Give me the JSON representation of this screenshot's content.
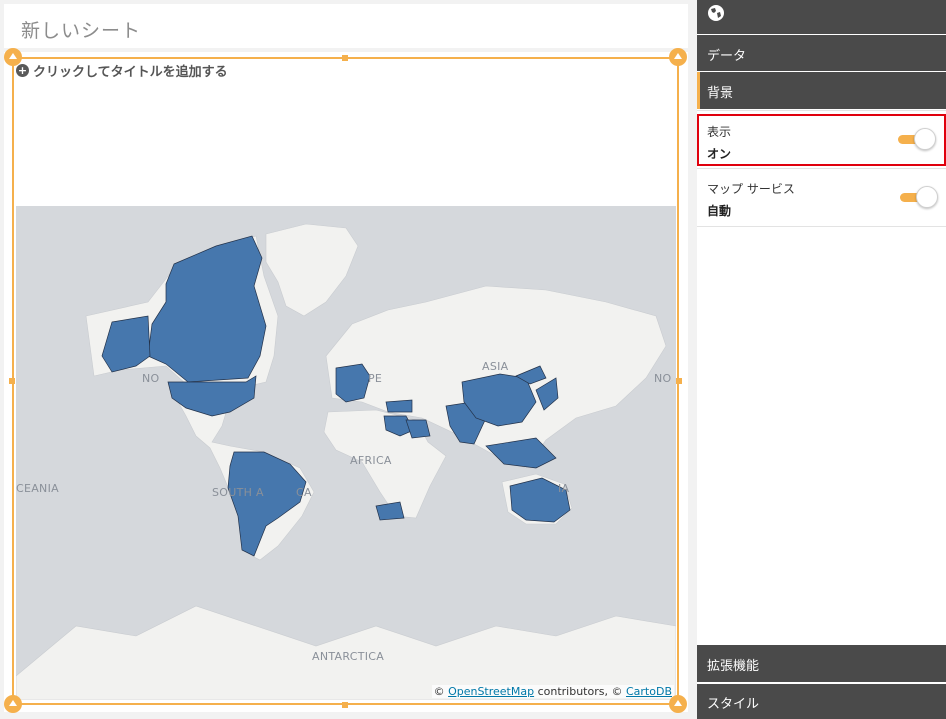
{
  "sheet": {
    "title": "新しいシート",
    "add_title_label": "クリックしてタイトルを追加する"
  },
  "map": {
    "labels": {
      "north_america": "NO",
      "north_america_right": "NO",
      "europe": "PE",
      "asia": "ASIA",
      "africa": "AFRICA",
      "south_america": "SOUTH A",
      "south_america_tail": "CA",
      "oceania_left": "CEANIA",
      "oceania_right": "IA",
      "antarctica": "ANTARCTICA"
    },
    "attribution": {
      "prefix": "© ",
      "osm": "OpenStreetMap",
      "mid": " contributors, © ",
      "carto": "CartoDB"
    },
    "colors": {
      "ocean": "#d5d8dc",
      "land": "#f2f2f0",
      "highlight": "#4677ad",
      "selection": "#f5b04c"
    }
  },
  "panel": {
    "top_icon": "globe-icon",
    "data_label": "データ",
    "background_label": "背景",
    "display": {
      "caption": "表示",
      "value": "オン"
    },
    "map_service": {
      "caption": "マップ サービス",
      "value": "自動"
    },
    "extensions_label": "拡張機能",
    "style_label": "スタイル"
  }
}
